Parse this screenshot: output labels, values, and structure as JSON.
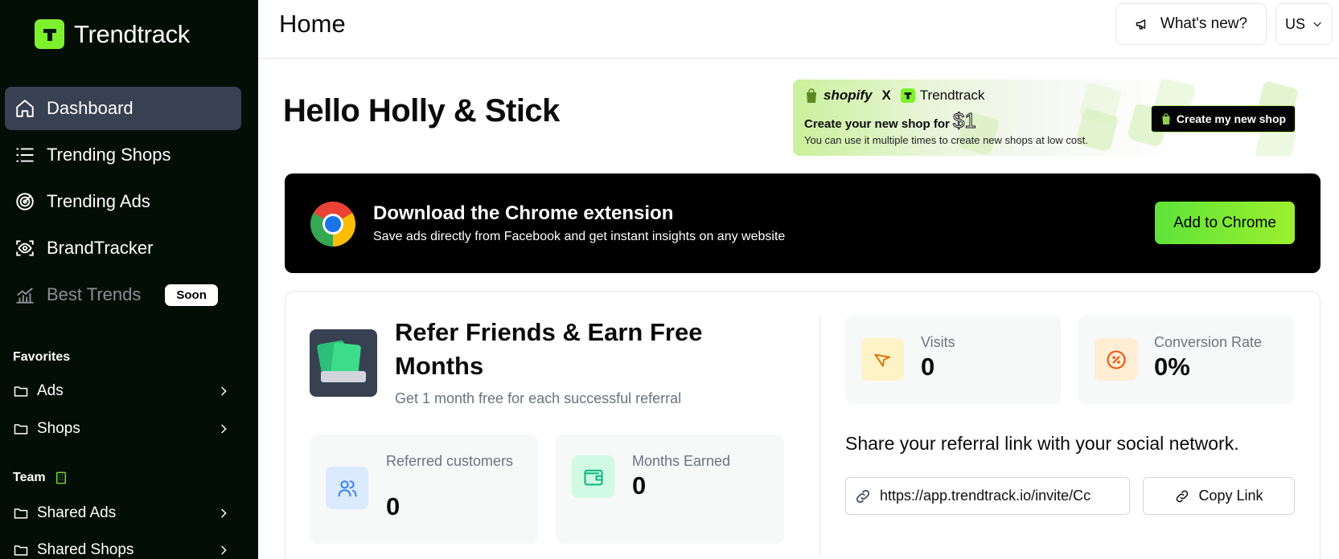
{
  "app": {
    "name": "Trendtrack"
  },
  "sidebar": {
    "nav": [
      {
        "label": "Dashboard",
        "icon": "home-icon",
        "active": true
      },
      {
        "label": "Trending Shops",
        "icon": "list-icon"
      },
      {
        "label": "Trending Ads",
        "icon": "target-icon"
      },
      {
        "label": "BrandTracker",
        "icon": "scan-eye-icon"
      },
      {
        "label": "Best Trends",
        "icon": "chart-icon",
        "badge": "Soon",
        "disabled": true
      }
    ],
    "favorites": {
      "title": "Favorites",
      "items": [
        {
          "label": "Ads"
        },
        {
          "label": "Shops"
        }
      ]
    },
    "team": {
      "title": "Team",
      "items": [
        {
          "label": "Shared Ads"
        },
        {
          "label": "Shared Shops"
        }
      ]
    }
  },
  "header": {
    "title": "Home",
    "whats_new_label": "What's new?",
    "language": "US"
  },
  "greeting": "Hello Holly & Stick",
  "promo": {
    "brand_left": "shopify",
    "x": "X",
    "brand_right": "Trendtrack",
    "headline": "Create your new shop for",
    "price": "$1",
    "description": "You can use it multiple times to create new shops at low cost.",
    "button_label": "Create my new shop"
  },
  "chrome_extension": {
    "title": "Download the Chrome extension",
    "subtitle": "Save ads directly from Facebook and get instant insights on any website",
    "button_label": "Add to Chrome"
  },
  "referral": {
    "title": "Refer Friends & Earn Free Months",
    "subtitle": "Get 1 month free for each successful referral",
    "stats": {
      "referred": {
        "label": "Referred customers",
        "value": "0"
      },
      "months": {
        "label": "Months Earned",
        "value": "0"
      },
      "visits": {
        "label": "Visits",
        "value": "0"
      },
      "conversion": {
        "label": "Conversion Rate",
        "value": "0%"
      }
    },
    "share_text": "Share your referral link with your social network.",
    "link_value": "https://app.trendtrack.io/invite/Cc",
    "copy_label": "Copy Link"
  },
  "colors": {
    "accent": "#7ef12f",
    "sidebar_bg": "#030e07",
    "active_nav_bg": "#374151"
  }
}
